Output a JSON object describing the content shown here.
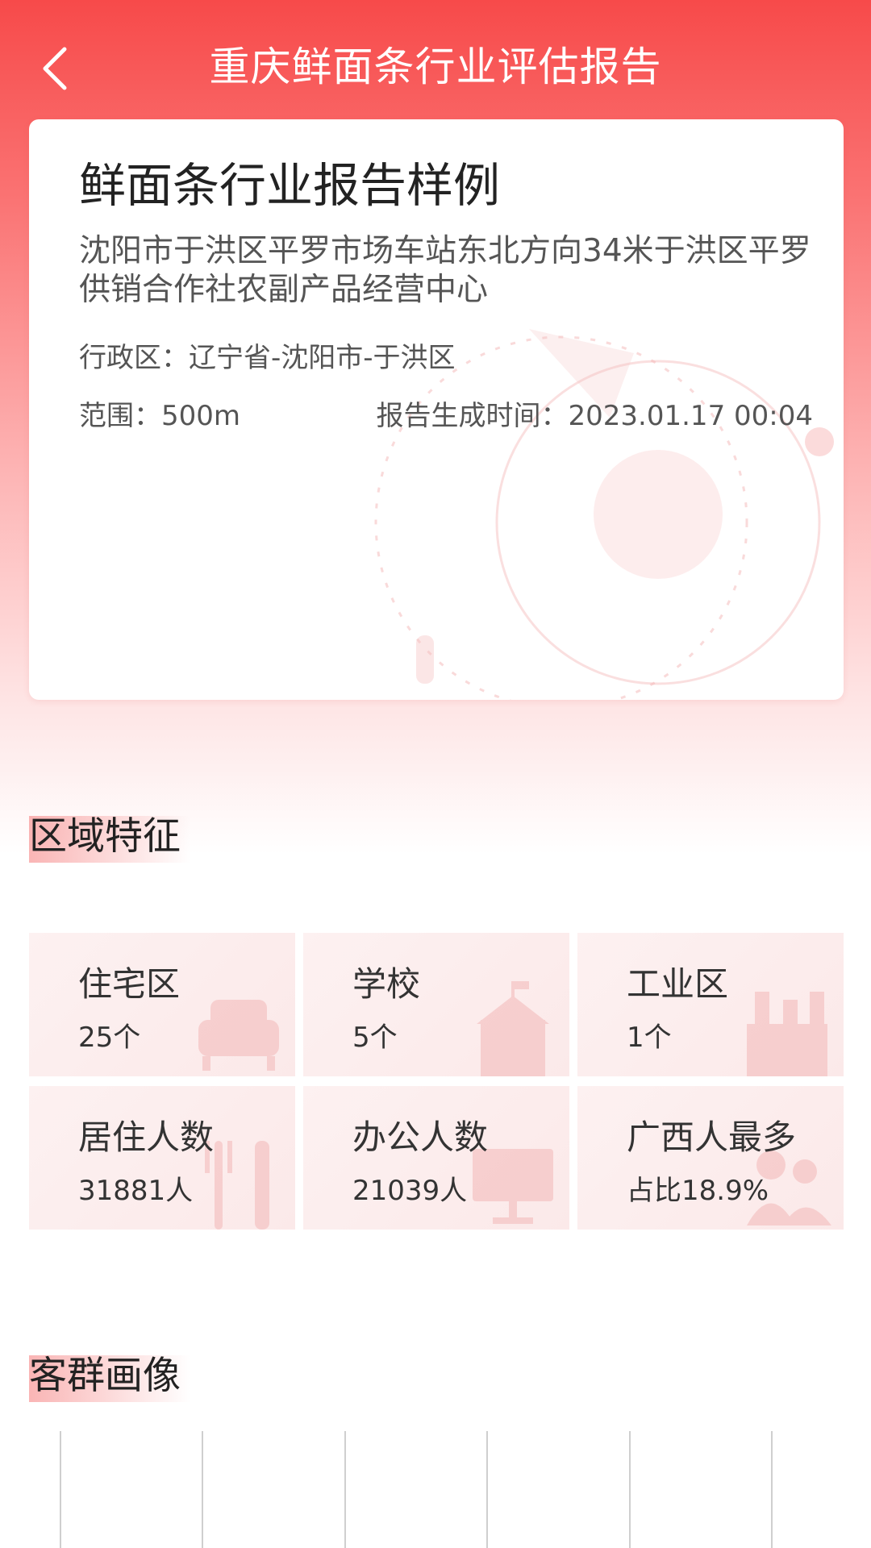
{
  "header": {
    "title": "重庆鲜面条行业评估报告",
    "back_icon": "chevron-left-icon"
  },
  "report_card": {
    "title": "鲜面条行业报告样例",
    "address": "沈阳市于洪区平罗市场车站东北方向34米于洪区平罗供销合作社农副产品经营中心",
    "district": "行政区：辽宁省-沈阳市-于洪区",
    "range": "范围：500m",
    "generated_time": "报告生成时间：2023.01.17 00:04"
  },
  "region_features": {
    "title": "区域特征",
    "items": [
      {
        "label": "住宅区",
        "value": "25个",
        "icon": "sofa-icon"
      },
      {
        "label": "学校",
        "value": "5个",
        "icon": "school-icon"
      },
      {
        "label": "工业区",
        "value": "1个",
        "icon": "factory-icon"
      },
      {
        "label": "居住人数",
        "value": "31881人",
        "icon": "utensils-icon"
      },
      {
        "label": "办公人数",
        "value": "21039人",
        "icon": "monitor-icon"
      },
      {
        "label": "广西人最多",
        "value": "占比18.9%",
        "icon": "people-icon"
      }
    ]
  },
  "customer_portrait": {
    "title": "客群画像"
  },
  "colors": {
    "header_red": "#f74a4a",
    "highlight": "#f57878"
  }
}
